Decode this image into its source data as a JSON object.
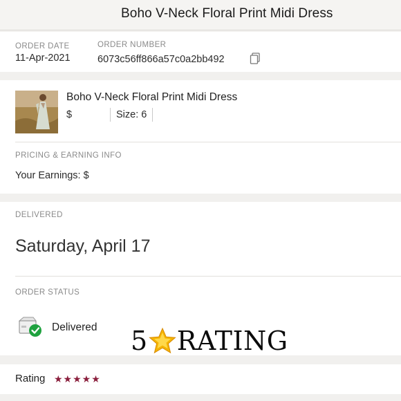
{
  "header": {
    "title": "Boho V-Neck Floral Print Midi Dress"
  },
  "order": {
    "date_label": "ORDER DATE",
    "date_value": "11-Apr-2021",
    "number_label": "ORDER NUMBER",
    "number_value": "6073c56ff866a57c0a2bb492",
    "copy_icon": "copy-icon"
  },
  "item": {
    "title": "Boho V-Neck Floral Print Midi Dress",
    "price": "$",
    "size": "Size: 6",
    "thumbnail_icon": "dress-photo"
  },
  "pricing": {
    "section_label": "PRICING & EARNING INFO",
    "earnings": "Your Earnings: $"
  },
  "delivery": {
    "section_label": "DELIVERED",
    "date": "Saturday, April 17"
  },
  "status": {
    "section_label": "ORDER STATUS",
    "value": "Delivered",
    "icon": "delivered-check-icon"
  },
  "overlay": {
    "prefix": "5",
    "suffix": "RATING",
    "icon": "star-icon"
  },
  "rating": {
    "label": "Rating",
    "stars": "★★★★★",
    "value": 5,
    "max": 5
  },
  "colors": {
    "star": "#8a1e3c",
    "check": "#1fa23f",
    "overlay_star": "#f5b400"
  }
}
